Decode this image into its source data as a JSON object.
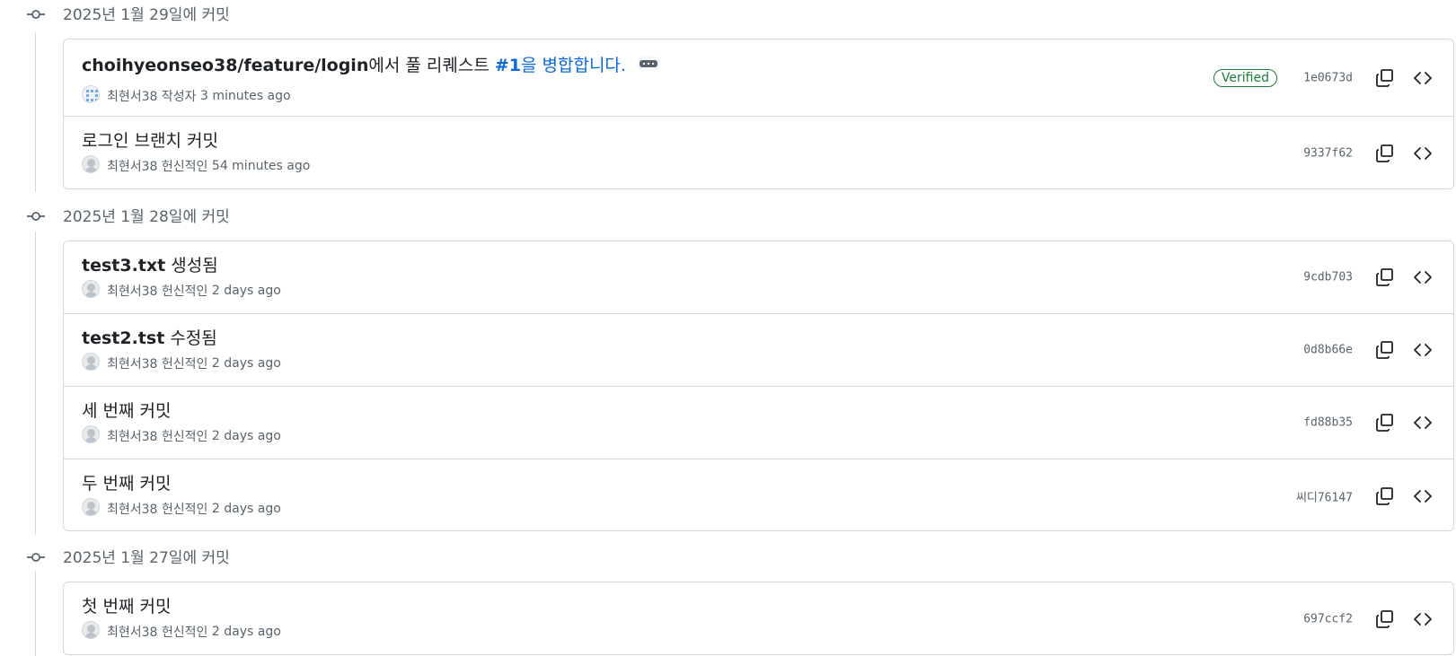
{
  "groups": [
    {
      "date": "2025년 1월 29일에 커밋",
      "commits": [
        {
          "title_bold": "choihyeonseo38/feature/login",
          "title_plain": "에서 풀 리퀘스트 ",
          "title_link": "#1",
          "title_tail": "을 병합합니다.",
          "author": "최현서38",
          "role": "작성자",
          "time": "3 minutes ago",
          "verified": "Verified",
          "sha": "1e0673d"
        },
        {
          "title": "로그인 브랜치 커밋",
          "author": "최현서38",
          "role": "헌신적인",
          "time": "54 minutes ago",
          "sha": "9337f62"
        }
      ]
    },
    {
      "date": "2025년 1월 28일에 커밋",
      "commits": [
        {
          "title_bold": "test3.txt",
          "title_plain": " 생성됨",
          "author": "최현서38",
          "role": "헌신적인",
          "time": "2 days ago",
          "sha": "9cdb703"
        },
        {
          "title_bold": "test2.tst",
          "title_plain": " 수정됨",
          "author": "최현서38",
          "role": "헌신적인",
          "time": "2 days ago",
          "sha": "0d8b66e"
        },
        {
          "title": "세 번째 커밋",
          "author": "최현서38",
          "role": "헌신적인",
          "time": "2 days ago",
          "sha": "fd88b35"
        },
        {
          "title": "두 번째 커밋",
          "author": "최현서38",
          "role": "헌신적인",
          "time": "2 days ago",
          "sha": "씨디76147"
        }
      ]
    },
    {
      "date": "2025년 1월 27일에 커밋",
      "commits": [
        {
          "title": "첫 번째 커밋",
          "author": "최현서38",
          "role": "헌신적인",
          "time": "2 days ago",
          "sha": "697ccf2"
        }
      ]
    }
  ],
  "icons": {
    "commit": "git-commit-icon",
    "copy": "copy-icon",
    "browse": "code-browse-icon",
    "more": "ellipsis-icon"
  },
  "colors": {
    "verified": "#1a7f37",
    "link": "#0969da",
    "border": "#d1d9e0",
    "muted": "#59636e"
  }
}
